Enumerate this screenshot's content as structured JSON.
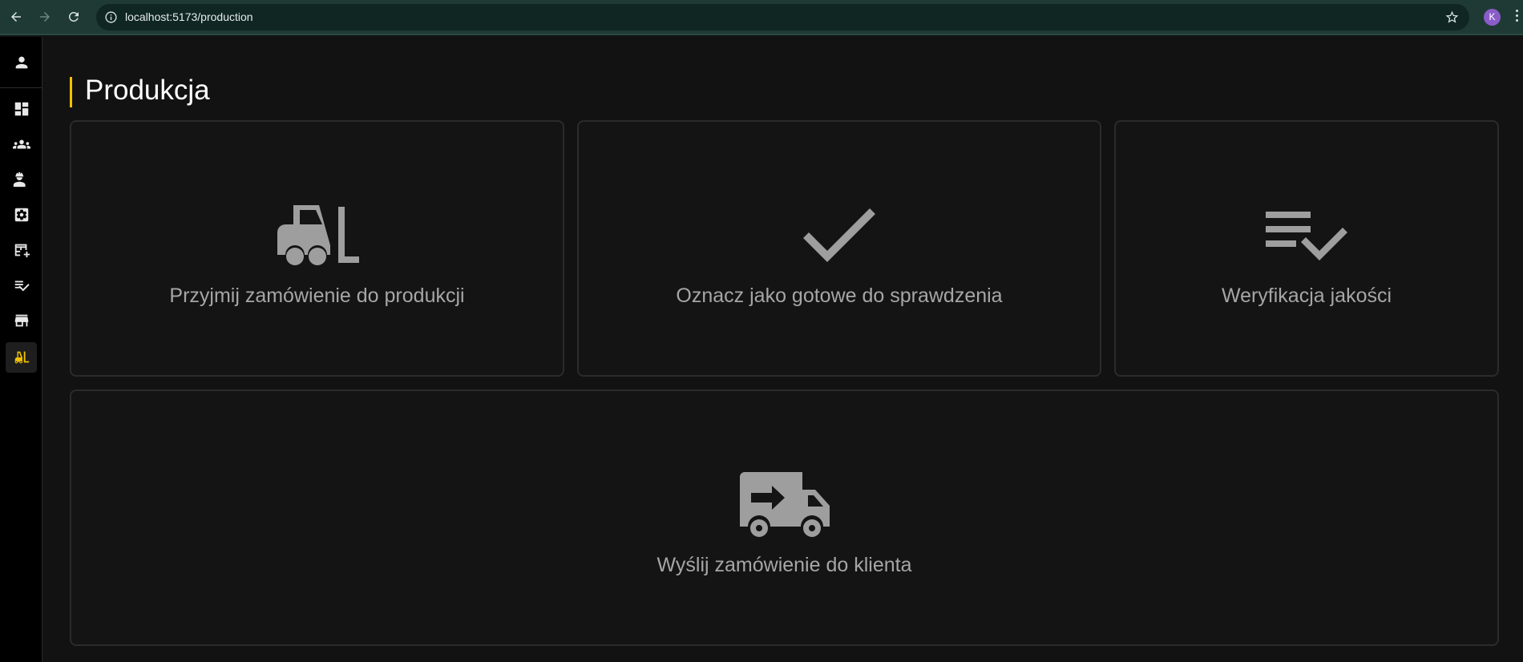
{
  "browser": {
    "url": "localhost:5173/production",
    "profile_initial": "K"
  },
  "sidebar": {
    "items": [
      {
        "name": "account",
        "icon": "person-icon",
        "active": false
      },
      {
        "name": "dashboard",
        "icon": "dashboard-icon",
        "active": false
      },
      {
        "name": "customers",
        "icon": "groups-icon",
        "active": false
      },
      {
        "name": "employees",
        "icon": "engineer-icon",
        "active": false
      },
      {
        "name": "settings",
        "icon": "settings-box-icon",
        "active": false
      },
      {
        "name": "table-add",
        "icon": "table-add-icon",
        "active": false
      },
      {
        "name": "checklist",
        "icon": "checklist-icon",
        "active": false
      },
      {
        "name": "store",
        "icon": "store-icon",
        "active": false
      },
      {
        "name": "production",
        "icon": "forklift-icon",
        "active": true
      }
    ]
  },
  "page": {
    "title": "Produkcja"
  },
  "cards": {
    "accept": {
      "label": "Przyjmij zamówienie do produkcji",
      "icon": "forklift-icon"
    },
    "ready": {
      "label": "Oznacz jako gotowe do sprawdzenia",
      "icon": "check-icon"
    },
    "quality": {
      "label": "Weryfikacja jakości",
      "icon": "checklist-icon"
    },
    "ship": {
      "label": "Wyślij zamówienie do klienta",
      "icon": "truck-arrow-icon"
    }
  },
  "colors": {
    "accent": "#f2c200",
    "background": "#121212",
    "card_border": "#2b2b2b",
    "icon": "#9e9e9e"
  }
}
